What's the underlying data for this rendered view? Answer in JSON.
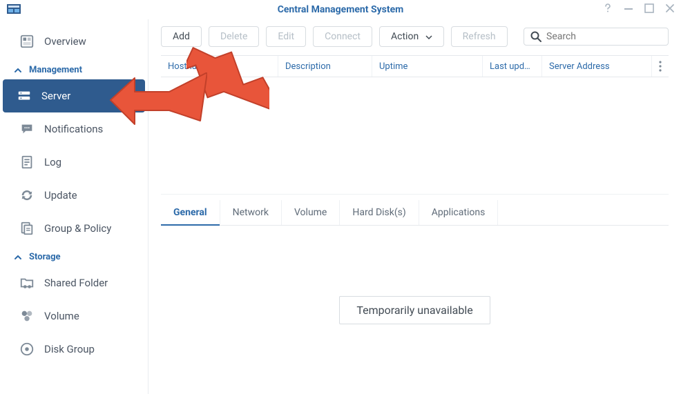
{
  "window": {
    "title": "Central Management System"
  },
  "sidebar": {
    "items": [
      {
        "label": "Overview"
      }
    ],
    "sections": [
      {
        "title": "Management",
        "items": [
          {
            "label": "Server",
            "active": true
          },
          {
            "label": "Notifications"
          },
          {
            "label": "Log"
          },
          {
            "label": "Update"
          },
          {
            "label": "Group & Policy"
          }
        ]
      },
      {
        "title": "Storage",
        "items": [
          {
            "label": "Shared Folder"
          },
          {
            "label": "Volume"
          },
          {
            "label": "Disk Group"
          }
        ]
      }
    ]
  },
  "toolbar": {
    "add": "Add",
    "delete": "Delete",
    "edit": "Edit",
    "connect": "Connect",
    "action": "Action",
    "refresh": "Refresh"
  },
  "search": {
    "placeholder": "Search"
  },
  "columns": {
    "hostname": "Hostname",
    "description": "Description",
    "uptime": "Uptime",
    "last_updated": "Last upd…",
    "server_address": "Server Address"
  },
  "detail_tabs": {
    "general": "General",
    "network": "Network",
    "volume": "Volume",
    "hard_disks": "Hard Disk(s)",
    "applications": "Applications"
  },
  "detail_panel": {
    "placeholder": "Temporarily unavailable"
  }
}
